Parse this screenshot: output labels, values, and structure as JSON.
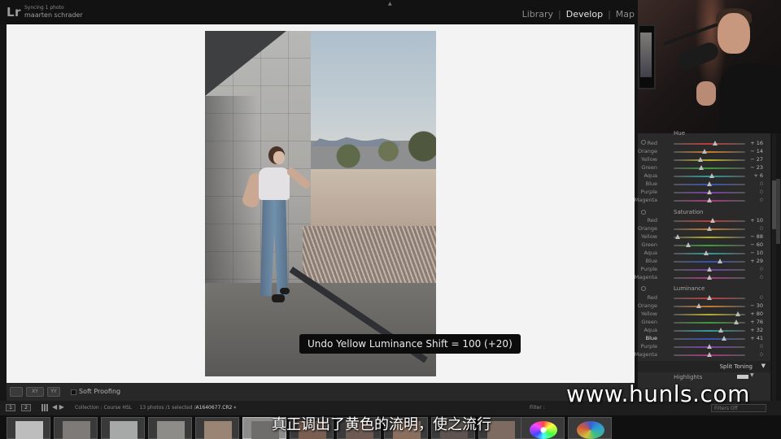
{
  "app": {
    "logo": "Lr",
    "sync_status": "Syncing 1 photo",
    "user_name": "maarten schrader"
  },
  "modules": [
    {
      "label": "Library",
      "active": false
    },
    {
      "label": "Develop",
      "active": true
    },
    {
      "label": "Map",
      "active": false
    }
  ],
  "hud_message": "Undo Yellow Luminance Shift = 100 (+20)",
  "toolbar": {
    "soft_proofing_label": "Soft Proofing",
    "compare_label": "XY",
    "survey_label": "YY"
  },
  "hsl": {
    "hue": {
      "title": "Hue",
      "rows": [
        {
          "label": "Red",
          "value": "+ 16",
          "level": 0.58,
          "color": "#c23a3a"
        },
        {
          "label": "Orange",
          "value": "− 14",
          "level": 0.43,
          "color": "#c77a2f"
        },
        {
          "label": "Yellow",
          "value": "− 27",
          "level": 0.37,
          "color": "#b5ad2e"
        },
        {
          "label": "Green",
          "value": "− 23",
          "level": 0.39,
          "color": "#3e9a3c"
        },
        {
          "label": "Aqua",
          "value": "+ 6",
          "level": 0.53,
          "color": "#2f9c9a"
        },
        {
          "label": "Blue",
          "value": "0",
          "level": 0.5,
          "color": "#3452b5"
        },
        {
          "label": "Purple",
          "value": "0",
          "level": 0.5,
          "color": "#7a3eaa"
        },
        {
          "label": "Magenta",
          "value": "0",
          "level": 0.5,
          "color": "#a8357f"
        }
      ]
    },
    "saturation": {
      "title": "Saturation",
      "rows": [
        {
          "label": "Red",
          "value": "+ 10",
          "level": 0.55,
          "color": "#c23a3a"
        },
        {
          "label": "Orange",
          "value": "0",
          "level": 0.5,
          "color": "#c77a2f"
        },
        {
          "label": "Yellow",
          "value": "− 88",
          "level": 0.06,
          "color": "#b5ad2e"
        },
        {
          "label": "Green",
          "value": "− 60",
          "level": 0.2,
          "color": "#3e9a3c"
        },
        {
          "label": "Aqua",
          "value": "− 10",
          "level": 0.45,
          "color": "#2f9c9a"
        },
        {
          "label": "Blue",
          "value": "+ 29",
          "level": 0.645,
          "color": "#3452b5"
        },
        {
          "label": "Purple",
          "value": "0",
          "level": 0.5,
          "color": "#7a3eaa"
        },
        {
          "label": "Magenta",
          "value": "0",
          "level": 0.5,
          "color": "#a8357f"
        }
      ]
    },
    "luminance": {
      "title": "Luminance",
      "rows": [
        {
          "label": "Red",
          "value": "0",
          "level": 0.5,
          "color": "#c23a3a"
        },
        {
          "label": "Orange",
          "value": "− 30",
          "level": 0.35,
          "color": "#c77a2f"
        },
        {
          "label": "Yellow",
          "value": "+ 80",
          "level": 0.9,
          "color": "#b5ad2e"
        },
        {
          "label": "Green",
          "value": "+ 76",
          "level": 0.88,
          "color": "#3e9a3c"
        },
        {
          "label": "Aqua",
          "value": "+ 32",
          "level": 0.66,
          "color": "#2f9c9a"
        },
        {
          "label": "Blue",
          "value": "+ 41",
          "level": 0.705,
          "color": "#3452b5",
          "highlighted": true
        },
        {
          "label": "Purple",
          "value": "0",
          "level": 0.5,
          "color": "#7a3eaa"
        },
        {
          "label": "Magenta",
          "value": "0",
          "level": 0.5,
          "color": "#a8357f"
        }
      ]
    }
  },
  "split_toning": {
    "title": "Split Toning",
    "highlights_label": "Highlights"
  },
  "filmstrip": {
    "view1": "1",
    "view2": "2",
    "collection_path": "Collection : Course HSL",
    "photo_count": "13 photos /1 selected /",
    "file_name": "A1640677.CR2",
    "filter_label": "Filter :",
    "filters_off": "Filters Off"
  },
  "overlay": {
    "watermark": "www.hunls.com",
    "subtitle": "真正调出了黄色的流明，使之流行"
  }
}
